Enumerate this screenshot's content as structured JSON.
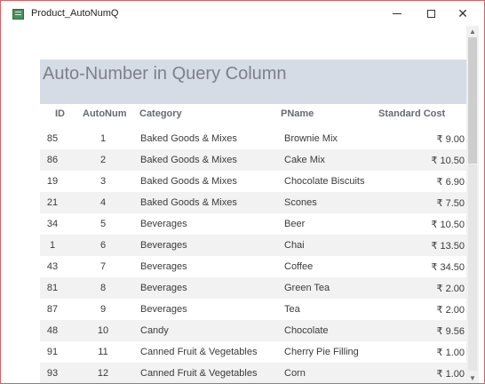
{
  "window": {
    "title": "Product_AutoNumQ",
    "icons": {
      "app": "access-form-icon",
      "minimize": "minimize-icon",
      "maximize": "maximize-icon",
      "close": "close-icon"
    }
  },
  "report": {
    "title": "Auto-Number in Query Column",
    "columns": {
      "id": "ID",
      "autonum": "AutoNum",
      "category": "Category",
      "pname": "PName",
      "cost": "Standard Cost"
    },
    "rows": [
      {
        "id": "85",
        "autonum": "1",
        "category": "Baked Goods & Mixes",
        "pname": "Brownie Mix",
        "cost": "₹ 9.00"
      },
      {
        "id": "86",
        "autonum": "2",
        "category": "Baked Goods & Mixes",
        "pname": "Cake Mix",
        "cost": "₹ 10.50"
      },
      {
        "id": "19",
        "autonum": "3",
        "category": "Baked Goods & Mixes",
        "pname": "Chocolate Biscuits",
        "cost": "₹ 6.90"
      },
      {
        "id": "21",
        "autonum": "4",
        "category": "Baked Goods & Mixes",
        "pname": "Scones",
        "cost": "₹ 7.50"
      },
      {
        "id": "34",
        "autonum": "5",
        "category": "Beverages",
        "pname": "Beer",
        "cost": "₹ 10.50"
      },
      {
        "id": "1",
        "autonum": "6",
        "category": "Beverages",
        "pname": "Chai",
        "cost": "₹ 13.50"
      },
      {
        "id": "43",
        "autonum": "7",
        "category": "Beverages",
        "pname": "Coffee",
        "cost": "₹ 34.50"
      },
      {
        "id": "81",
        "autonum": "8",
        "category": "Beverages",
        "pname": "Green Tea",
        "cost": "₹ 2.00"
      },
      {
        "id": "87",
        "autonum": "9",
        "category": "Beverages",
        "pname": "Tea",
        "cost": "₹ 2.00"
      },
      {
        "id": "48",
        "autonum": "10",
        "category": "Candy",
        "pname": "Chocolate",
        "cost": "₹ 9.56"
      },
      {
        "id": "91",
        "autonum": "11",
        "category": "Canned Fruit & Vegetables",
        "pname": "Cherry Pie Filling",
        "cost": "₹ 1.00"
      },
      {
        "id": "93",
        "autonum": "12",
        "category": "Canned Fruit & Vegetables",
        "pname": "Corn",
        "cost": "₹ 1.00"
      }
    ]
  },
  "colors": {
    "header_band": "#d5dce6",
    "alt_row": "#f2f2f2",
    "window_border": "#c7686b"
  }
}
